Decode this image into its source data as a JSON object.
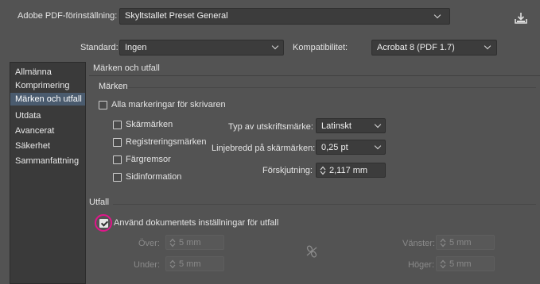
{
  "header": {
    "preset_label": "Adobe PDF-förinställning:",
    "preset_value": "Skyltstallet Preset General",
    "save_icon": "save-preset-icon"
  },
  "standards": {
    "standard_label": "Standard:",
    "standard_value": "Ingen",
    "compat_label": "Kompatibilitet:",
    "compat_value": "Acrobat 8 (PDF 1.7)"
  },
  "sidebar": {
    "items": [
      {
        "label": "Allmänna"
      },
      {
        "label": "Komprimering"
      },
      {
        "label": "Märken och utfall"
      },
      {
        "label": "Utdata"
      },
      {
        "label": "Avancerat"
      },
      {
        "label": "Säkerhet"
      },
      {
        "label": "Sammanfattning"
      }
    ],
    "selected_index": 2
  },
  "main": {
    "section_title": "Märken och utfall",
    "marks": {
      "title": "Märken",
      "all_marks": {
        "label": "Alla markeringar för skrivaren",
        "checked": false
      },
      "crop_marks": {
        "label": "Skärmärken",
        "checked": false
      },
      "registration_marks": {
        "label": "Registreringsmärken",
        "checked": false
      },
      "color_bars": {
        "label": "Färgremsor",
        "checked": false
      },
      "page_info": {
        "label": "Sidinformation",
        "checked": false
      },
      "type_label": "Typ av utskriftsmärke:",
      "type_value": "Latinskt",
      "weight_label": "Linjebredd på skärmärken:",
      "weight_value": "0,25 pt",
      "offset_label": "Förskjutning:",
      "offset_value": "2,117 mm"
    },
    "bleed": {
      "title": "Utfall",
      "use_document": {
        "label": "Använd dokumentets inställningar för utfall",
        "checked": true
      },
      "top_label": "Över:",
      "top_value": "5 mm",
      "bottom_label": "Under:",
      "bottom_value": "5 mm",
      "left_label": "Vänster:",
      "left_value": "5 mm",
      "right_label": "Höger:",
      "right_value": "5 mm",
      "link_icon": "chain-link-icon"
    }
  }
}
